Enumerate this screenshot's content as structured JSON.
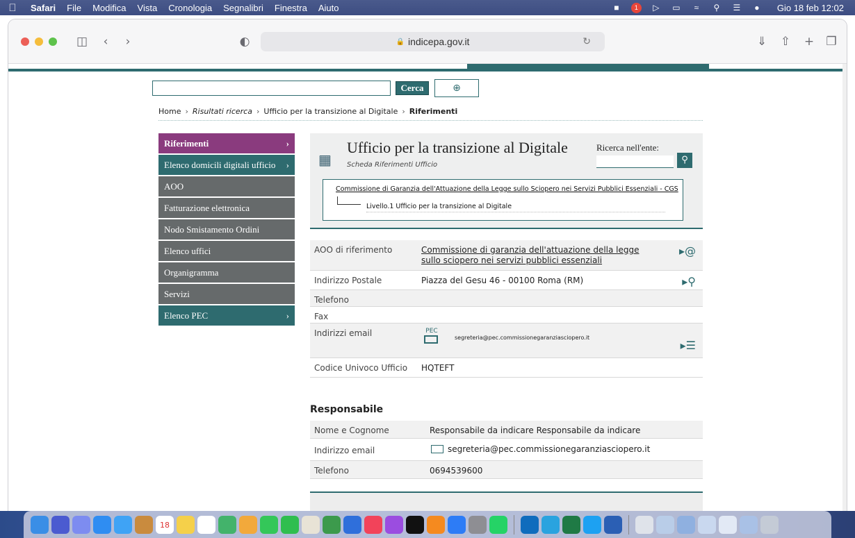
{
  "menubar": {
    "app_name": "Safari",
    "items": [
      "File",
      "Modifica",
      "Vista",
      "Cronologia",
      "Segnalibri",
      "Finestra",
      "Aiuto"
    ],
    "clock": "Gio 18 feb  12:02",
    "badge_count": "1"
  },
  "browser": {
    "url": "indicepa.gov.it"
  },
  "search": {
    "button_label": "Cerca"
  },
  "breadcrumb": {
    "home": "Home",
    "results": "Risultati ricerca",
    "office": "Ufficio per la transizione al Digitale",
    "current": "Riferimenti"
  },
  "sidebar": {
    "items": [
      {
        "label": "Riferimenti",
        "chevron": "›"
      },
      {
        "label": "Elenco domicili digitali ufficio",
        "chevron": "›"
      },
      {
        "label": "AOO",
        "chevron": ""
      },
      {
        "label": "Fatturazione elettronica",
        "chevron": ""
      },
      {
        "label": "Nodo Smistamento Ordini",
        "chevron": ""
      },
      {
        "label": "Elenco uffici",
        "chevron": ""
      },
      {
        "label": "Organigramma",
        "chevron": ""
      },
      {
        "label": "Servizi",
        "chevron": ""
      },
      {
        "label": "Elenco PEC",
        "chevron": "›"
      }
    ]
  },
  "header": {
    "title": "Ufficio per la transizione al Digitale",
    "subtitle": "Scheda Riferimenti Ufficio",
    "search_label": "Ricerca nell'ente:",
    "hierarchy_parent": "Commissione di Garanzia dell'Attuazione della Legge sullo Sciopero nei Servizi Pubblici Essenziali - CGS",
    "hierarchy_child": "Livello.1 Ufficio per la transizione al Digitale"
  },
  "details": {
    "aoo_label": "AOO di riferimento",
    "aoo_value": "Commissione di garanzia dell'attuazione della legge sullo sciopero nei servizi pubblici essenziali",
    "address_label": "Indirizzo Postale",
    "address_value": "Piazza del Gesu 46 - 00100 Roma (RM)",
    "phone_label": "Telefono",
    "fax_label": "Fax",
    "email_label": "Indirizzi email",
    "email_value": "segreteria@pec.commissionegaranziasciopero.it",
    "pec_tag": "PEC",
    "code_label": "Codice Univoco Ufficio",
    "code_value": "HQTEFT"
  },
  "responsabile": {
    "title": "Responsabile",
    "name_label": "Nome e Cognome",
    "name_value": "Responsabile da indicare Responsabile da indicare",
    "email_label": "Indirizzo email",
    "email_value": "segreteria@pec.commissionegaranziasciopero.it",
    "phone_label": "Telefono",
    "phone_value": "0694539600"
  },
  "colors": {
    "accent": "#2e6b6f",
    "active": "#8a3b7e",
    "menu_gray": "#666a6b"
  },
  "dock": {
    "calendar_day": "18"
  }
}
